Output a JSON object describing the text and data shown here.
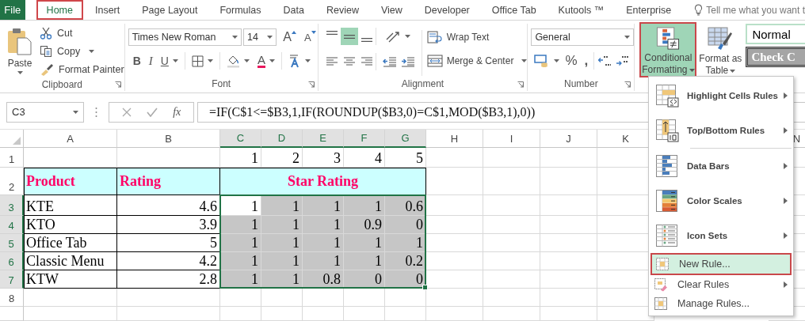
{
  "file_tab": "File",
  "tabs": [
    {
      "label": "Home",
      "selected": true
    },
    {
      "label": "Insert",
      "selected": false
    },
    {
      "label": "Page Layout",
      "selected": false
    },
    {
      "label": "Formulas",
      "selected": false
    },
    {
      "label": "Data",
      "selected": false
    },
    {
      "label": "Review",
      "selected": false
    },
    {
      "label": "View",
      "selected": false
    },
    {
      "label": "Developer",
      "selected": false
    },
    {
      "label": "Office Tab",
      "selected": false
    },
    {
      "label": "Kutools ™",
      "selected": false
    },
    {
      "label": "Enterprise",
      "selected": false
    }
  ],
  "tell_me": "Tell me what you want t",
  "clipboard": {
    "paste": "Paste",
    "cut": "Cut",
    "copy": "Copy",
    "format_painter": "Format Painter",
    "label": "Clipboard"
  },
  "font": {
    "name": "Times New Roman",
    "size": "14",
    "grow": "A",
    "shrink": "A",
    "bold": "B",
    "italic": "I",
    "underline": "U",
    "color_letter": "A",
    "label": "Font"
  },
  "alignment": {
    "vertical": [
      {
        "selected": false
      },
      {
        "selected": true
      },
      {
        "selected": false
      }
    ],
    "wrap_text": "Wrap Text",
    "merge_center": "Merge & Center",
    "label": "Alignment"
  },
  "number": {
    "format": "General",
    "percent": "%",
    "comma": ",",
    "label": "Number"
  },
  "conditional_formatting": {
    "label": "Conditional Formatting",
    "selected": true
  },
  "format_as_table": "Format as Table",
  "cell_styles": [
    {
      "label": "Normal",
      "kind": "normal"
    },
    {
      "label": "Check C",
      "kind": "check"
    }
  ],
  "formula_bar": {
    "name_box": "C3",
    "fx": "fx",
    "formula": "=IF(C$1<=$B3,1,IF(ROUNDUP($B3,0)=C$1,MOD($B3,1),0))"
  },
  "sheet": {
    "columns": [
      {
        "label": "A",
        "selected": false
      },
      {
        "label": "B",
        "selected": false
      },
      {
        "label": "C",
        "selected": true
      },
      {
        "label": "D",
        "selected": true
      },
      {
        "label": "E",
        "selected": true
      },
      {
        "label": "F",
        "selected": true
      },
      {
        "label": "G",
        "selected": true
      },
      {
        "label": "H",
        "selected": false
      },
      {
        "label": "I",
        "selected": false
      },
      {
        "label": "J",
        "selected": false
      },
      {
        "label": "K",
        "selected": false
      },
      {
        "label": "N",
        "selected": false
      }
    ],
    "row_labels": [
      {
        "label": "1",
        "selected": false
      },
      {
        "label": "2",
        "selected": false
      },
      {
        "label": "3",
        "selected": true
      },
      {
        "label": "4",
        "selected": true
      },
      {
        "label": "5",
        "selected": true
      },
      {
        "label": "6",
        "selected": true
      },
      {
        "label": "7",
        "selected": true
      },
      {
        "label": "8",
        "selected": false
      }
    ],
    "column_numbers": [
      "1",
      "2",
      "3",
      "4",
      "5"
    ],
    "headers": {
      "product": "Product",
      "rating": "Rating",
      "star_rating": "Star Rating"
    },
    "rows": [
      {
        "product": "KTE",
        "rating": "4.6",
        "values": [
          "1",
          "1",
          "1",
          "1",
          "0.6"
        ]
      },
      {
        "product": "KTO",
        "rating": "3.9",
        "values": [
          "1",
          "1",
          "1",
          "0.9",
          "0"
        ]
      },
      {
        "product": "Office Tab",
        "rating": "5",
        "values": [
          "1",
          "1",
          "1",
          "1",
          "1"
        ]
      },
      {
        "product": "Classic Menu",
        "rating": "4.2",
        "values": [
          "1",
          "1",
          "1",
          "1",
          "0.2"
        ]
      },
      {
        "product": "KTW",
        "rating": "2.8",
        "values": [
          "1",
          "1",
          "0.8",
          "0",
          "0"
        ]
      }
    ]
  },
  "menu": {
    "groups": [
      [
        {
          "label": "Highlight Cells Rules",
          "kind": "highlight",
          "submenu": true,
          "selected": false
        },
        {
          "label": "Top/Bottom Rules",
          "kind": "topbottom",
          "submenu": true,
          "selected": false
        }
      ],
      [
        {
          "label": "Data Bars",
          "kind": "databars",
          "submenu": true,
          "selected": false
        },
        {
          "label": "Color Scales",
          "kind": "colorscales",
          "submenu": true,
          "selected": false
        },
        {
          "label": "Icon Sets",
          "kind": "iconsets",
          "submenu": true,
          "selected": false
        },
        {
          "label": "New Rule...",
          "kind": "newrule",
          "submenu": false,
          "selected": true
        },
        {
          "label": "Clear Rules",
          "kind": "clearrules",
          "submenu": true,
          "selected": false
        },
        {
          "label": "Manage Rules...",
          "kind": "managerules",
          "submenu": false,
          "selected": false
        }
      ]
    ]
  }
}
